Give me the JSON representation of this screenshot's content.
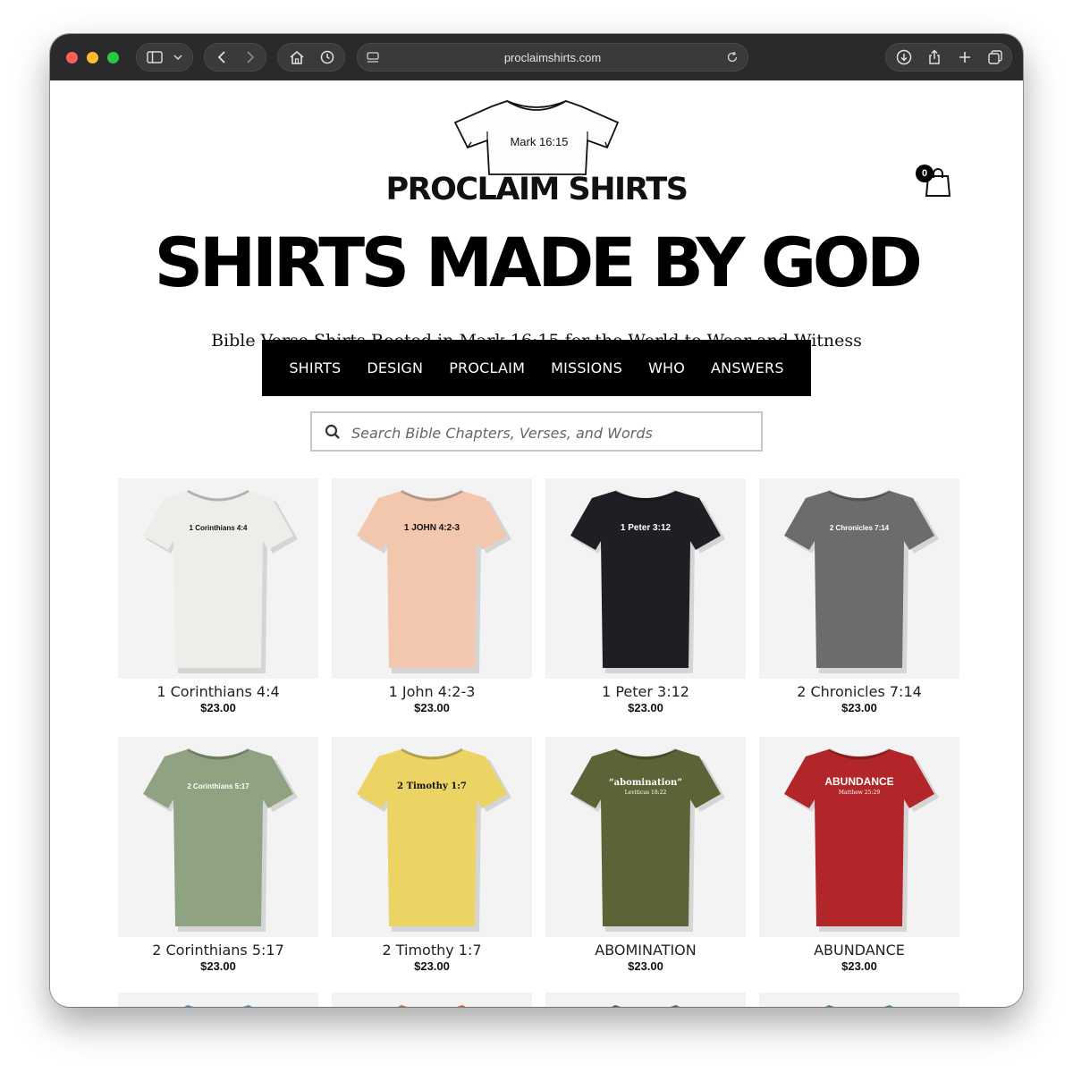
{
  "browser": {
    "url": "proclaimshirts.com"
  },
  "header": {
    "logo_shirt_text": "Mark 16:15",
    "brand": "PROCLAIM SHIRTS",
    "headline": "SHIRTS MADE BY GOD",
    "tagline": "Bible Verse Shirts Rooted in Mark 16:15 for the World to Wear and Witness",
    "cart_count": "0"
  },
  "nav": {
    "items": [
      {
        "label": "SHIRTS"
      },
      {
        "label": "DESIGN"
      },
      {
        "label": "PROCLAIM"
      },
      {
        "label": "MISSIONS"
      },
      {
        "label": "WHO"
      },
      {
        "label": "ANSWERS"
      }
    ]
  },
  "search": {
    "placeholder": "Search Bible Chapters, Verses, and Words"
  },
  "products": [
    {
      "name": "1 Corinthians 4:4",
      "price": "$23.00",
      "shirt_text": "1 Corinthians 4:4",
      "color": "#ededea",
      "text_color": "#111111"
    },
    {
      "name": "1 John 4:2-3",
      "price": "$23.00",
      "shirt_text": "1 JOHN 4:2-3",
      "color": "#f3c7ae",
      "text_color": "#111111"
    },
    {
      "name": "1 Peter 3:12",
      "price": "$23.00",
      "shirt_text": "1 Peter 3:12",
      "color": "#1d1f24",
      "text_color": "#ffffff"
    },
    {
      "name": "2 Chronicles 7:14",
      "price": "$23.00",
      "shirt_text": "2 Chronicles 7:14",
      "color": "#6c6c6c",
      "text_color": "#ffffff"
    },
    {
      "name": "2 Corinthians 5:17",
      "price": "$23.00",
      "shirt_text": "2 Corinthians 5:17",
      "color": "#8fa382",
      "text_color": "#ffffff"
    },
    {
      "name": "2 Timothy 1:7",
      "price": "$23.00",
      "shirt_text": "2 Timothy 1:7",
      "color": "#ecd464",
      "text_color": "#111111"
    },
    {
      "name": "ABOMINATION",
      "price": "$23.00",
      "shirt_text": "“abomination”",
      "shirt_sub": "Leviticus 18:22",
      "color": "#5a6437",
      "text_color": "#ffffff"
    },
    {
      "name": "ABUNDANCE",
      "price": "$23.00",
      "shirt_text": "ABUNDANCE",
      "shirt_sub": "Matthew 25:29",
      "color": "#b22629",
      "text_color": "#ffffff"
    }
  ],
  "peek_colors": [
    "#4a90b8",
    "#d9633a",
    "#55606a",
    "#3c8fa4"
  ],
  "colors": {
    "nav_bg": "#000000",
    "card_bg": "#f3f3f3"
  }
}
